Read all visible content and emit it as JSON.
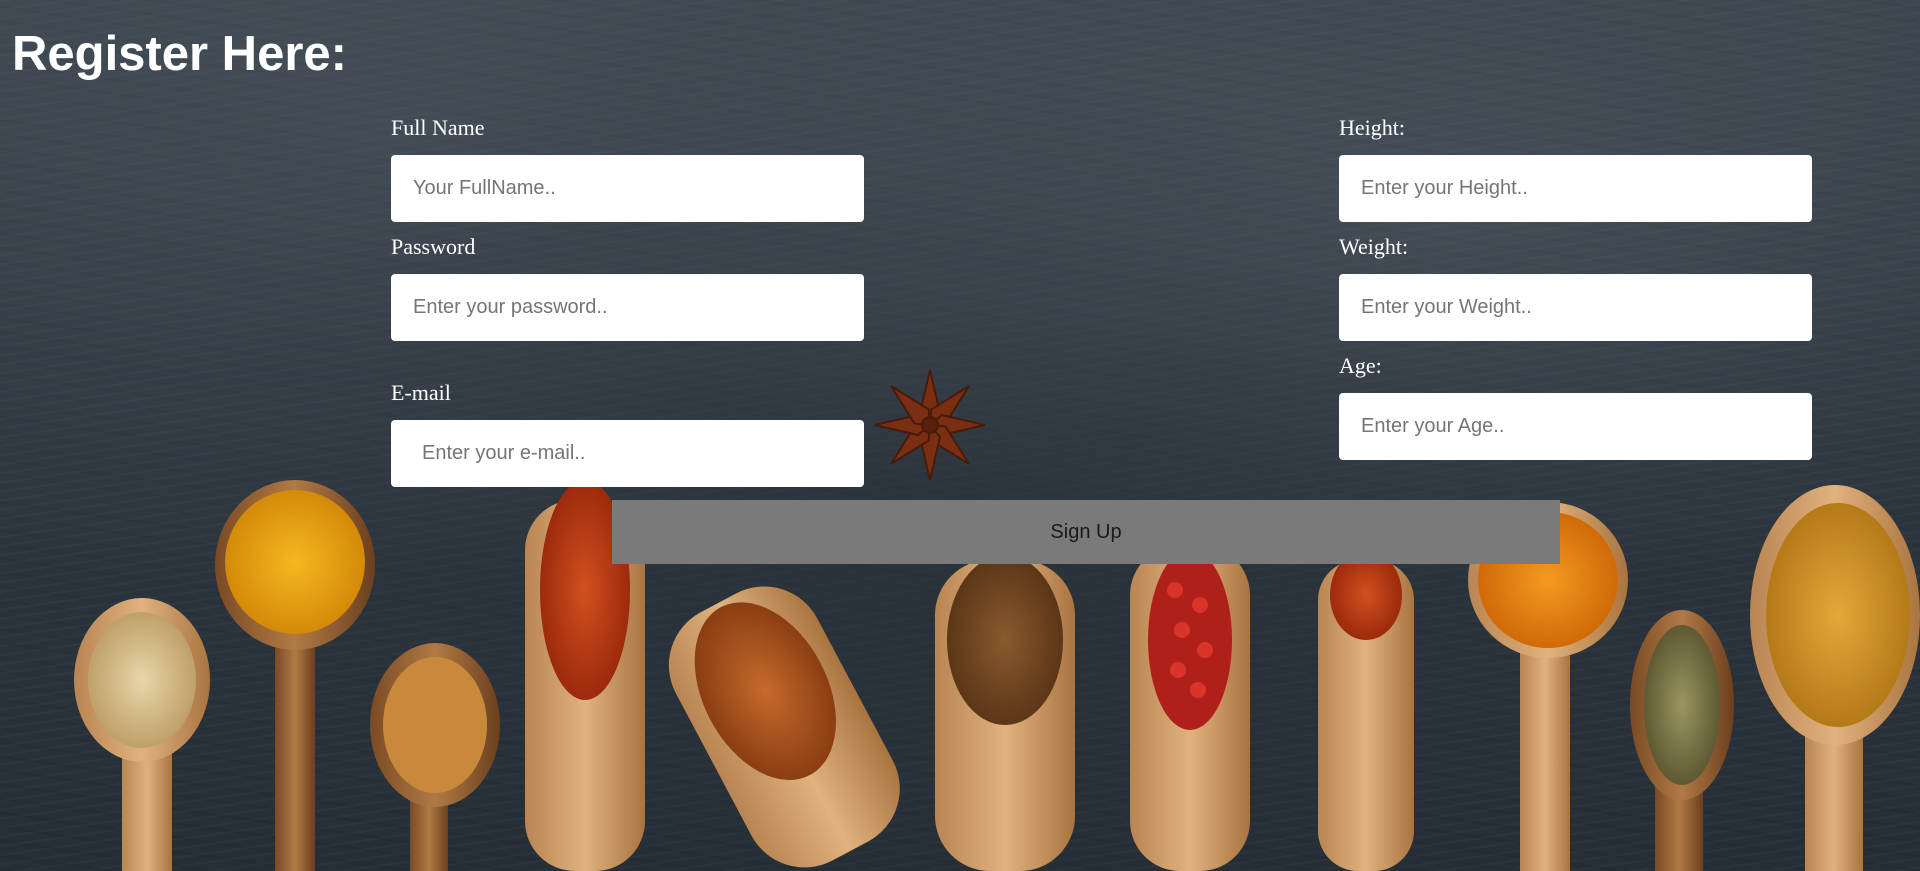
{
  "page": {
    "title": "Register Here:"
  },
  "form": {
    "full_name": {
      "label": "Full Name",
      "placeholder": "Your FullName.."
    },
    "password": {
      "label": "Password",
      "placeholder": "Enter your password.."
    },
    "email": {
      "label": "E-mail",
      "placeholder": "Enter your e-mail.."
    },
    "height": {
      "label": "Height:",
      "placeholder": "Enter your Height.."
    },
    "weight": {
      "label": "Weight:",
      "placeholder": "Enter your Weight.."
    },
    "age": {
      "label": "Age:",
      "placeholder": "Enter your Age.."
    },
    "signup_label": "Sign Up"
  },
  "colors": {
    "background": "#2e3740",
    "button": "#7a7a7a",
    "label_text": "#ffffff"
  },
  "background_image": {
    "description_icon": "spice-spoons-on-slate"
  }
}
